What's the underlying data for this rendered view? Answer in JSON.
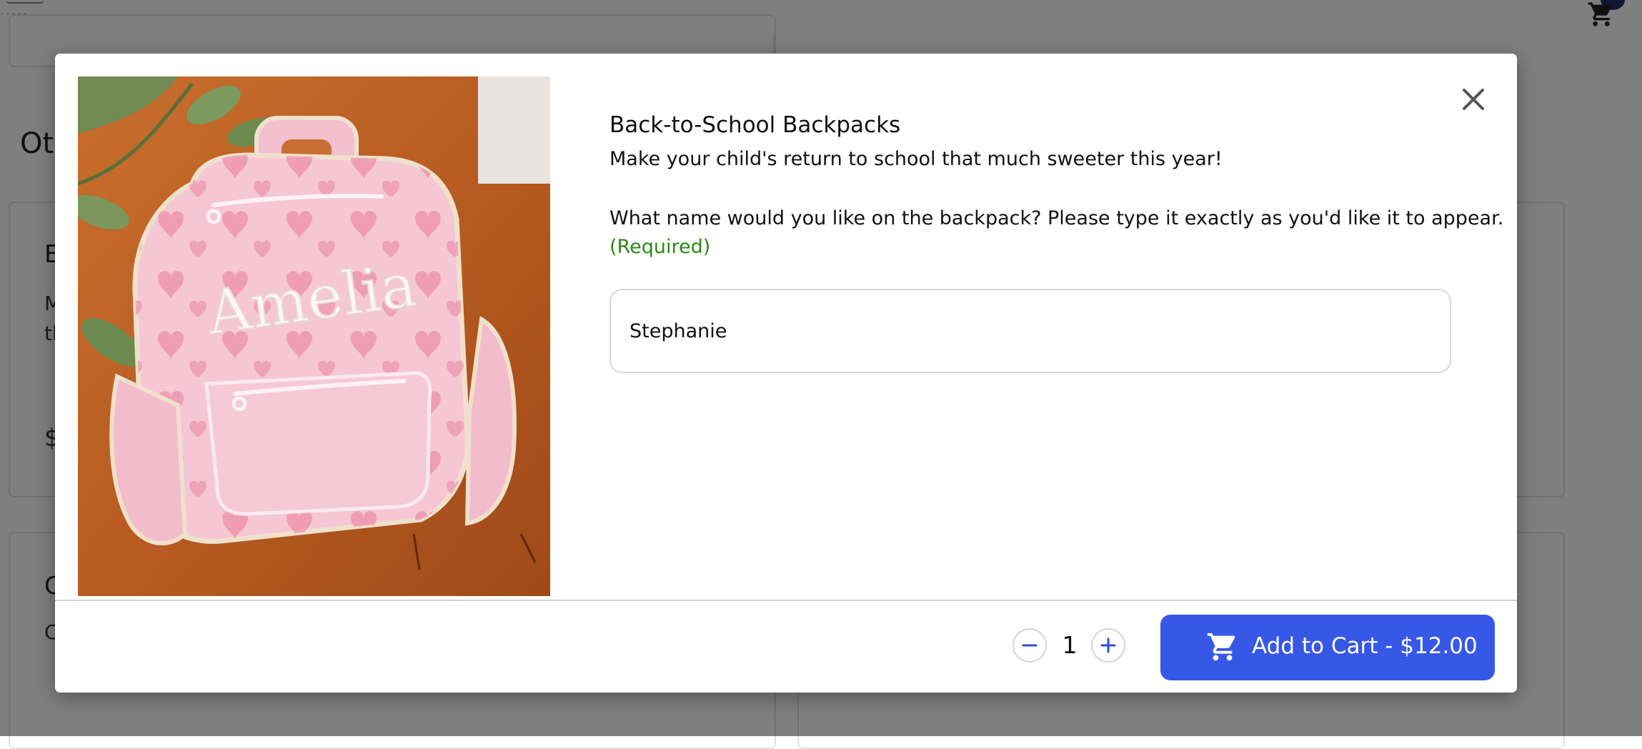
{
  "background_page": {
    "section_heading": "Oth",
    "card1": {
      "title": "B",
      "text_line1": "M",
      "text_line2": "th",
      "price": "$"
    },
    "card2": {
      "title": "C",
      "text": "C"
    }
  },
  "modal": {
    "product": {
      "title": "Back-to-School Backpacks",
      "description": "Make your child's return to school that much sweeter this year!",
      "image_alt": "Pink backpack-shaped decorated cookie reading Amelia",
      "image_lettering": "Amelia"
    },
    "personalization": {
      "question": "What name would you like on the backpack? Please type it exactly as you'd like it to appear.",
      "required_label": "(Required)",
      "name_value": "Stephanie"
    },
    "footer": {
      "quantity": "1",
      "add_to_cart_label": "Add to Cart - $12.00"
    },
    "icons": {
      "close": "close-icon",
      "minus": "minus-icon",
      "plus": "plus-icon",
      "cart": "shopping-cart-icon"
    },
    "colors": {
      "primary_button": "#3757e6",
      "required_text": "#2a8a14",
      "cookie_pink": "#f4c3d2",
      "heart_pink": "#e98aa6",
      "board_wood": "#c46a2c"
    }
  }
}
